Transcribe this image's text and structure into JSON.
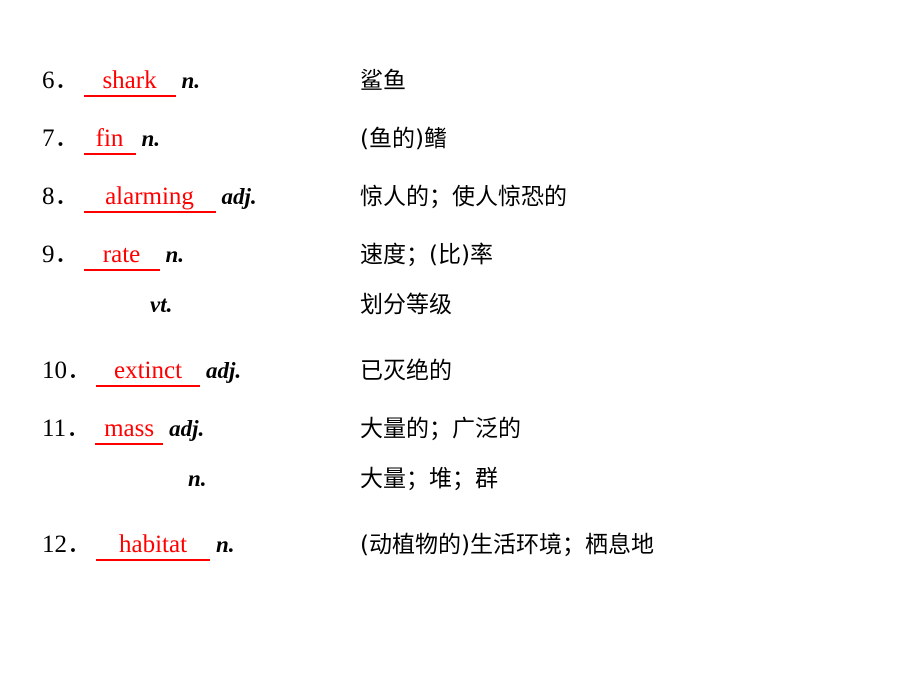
{
  "slide": {
    "items": [
      {
        "number": "6",
        "word": "shark",
        "pos": "n.",
        "meaning": "鲨鱼",
        "width_class": "w-shark"
      },
      {
        "number": "7",
        "word": "fin",
        "pos": "n.",
        "meaning": "(鱼的)鳍",
        "width_class": "w-fin"
      },
      {
        "number": "8",
        "word": "alarming",
        "pos": "adj.",
        "meaning": "惊人的；使人惊恐的",
        "width_class": "w-alarming"
      },
      {
        "number": "9",
        "word": "rate",
        "pos": "n.",
        "meaning": "速度；(比)率",
        "width_class": "w-rate"
      },
      {
        "number": "",
        "word": "",
        "pos": "vt.",
        "meaning": "划分等级",
        "width_class": ""
      },
      {
        "number": "10",
        "word": "extinct",
        "pos": "adj.",
        "meaning": "已灭绝的",
        "width_class": "w-extinct"
      },
      {
        "number": "11",
        "word": "mass",
        "pos": "adj.",
        "meaning": "大量的；广泛的",
        "width_class": "w-mass"
      },
      {
        "number": "",
        "word": "",
        "pos": "n.",
        "meaning": "大量；堆；群",
        "width_class": ""
      },
      {
        "number": "12",
        "word": "habitat",
        "pos": "n.",
        "meaning": "(动植物的)生活环境；栖息地",
        "width_class": "w-habitat"
      }
    ],
    "separator": "．",
    "colors": {
      "answer": "#ff0000",
      "text": "#000000",
      "background": "#ffffff"
    }
  }
}
